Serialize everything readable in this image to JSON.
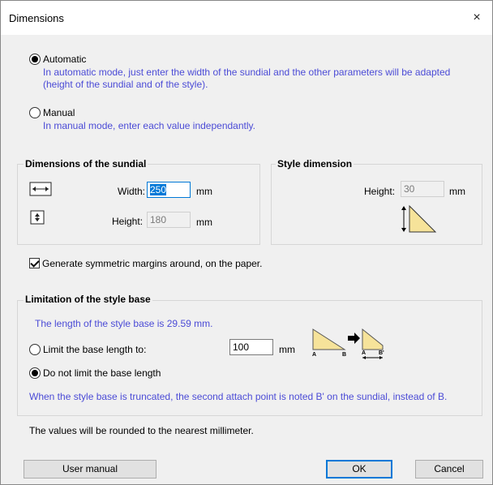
{
  "window": {
    "title": "Dimensions",
    "close_glyph": "×"
  },
  "mode": {
    "automatic_label": "Automatic",
    "automatic_desc": "In automatic mode, just enter the width of the sundial and the other parameters will be adapted (height of the sundial and of the style).",
    "manual_label": "Manual",
    "manual_desc": "In manual mode, enter each value independantly.",
    "selected": "automatic"
  },
  "sundial": {
    "group_title": "Dimensions of the sundial",
    "width_label": "Width:",
    "width_value": "250",
    "width_unit": "mm",
    "height_label": "Height:",
    "height_value": "180",
    "height_unit": "mm"
  },
  "style": {
    "group_title": "Style dimension",
    "height_label": "Height:",
    "height_value": "30",
    "height_unit": "mm"
  },
  "margins": {
    "checked": true,
    "label": "Generate symmetric margins around, on the paper."
  },
  "limitation": {
    "group_title": "Limitation of the style base",
    "info": "The length of the style base is 29.59 mm.",
    "limit_label": "Limit the base length to:",
    "limit_value": "100",
    "limit_unit": "mm",
    "no_limit_label": "Do not limit the base length",
    "selected": "no_limit",
    "note": "When the style base is truncated, the second attach point is noted B' on the sundial, instead of B.",
    "diagram_labels": {
      "a1": "A",
      "b1": "B",
      "a2": "A",
      "b2": "B'"
    }
  },
  "footer_note": "The values will be rounded to the nearest millimeter.",
  "buttons": {
    "user_manual": "User manual",
    "ok": "OK",
    "cancel": "Cancel"
  },
  "colors": {
    "accent": "#0078d7",
    "info_text": "#4b4bd6",
    "triangle_fill": "#f6e39a"
  }
}
